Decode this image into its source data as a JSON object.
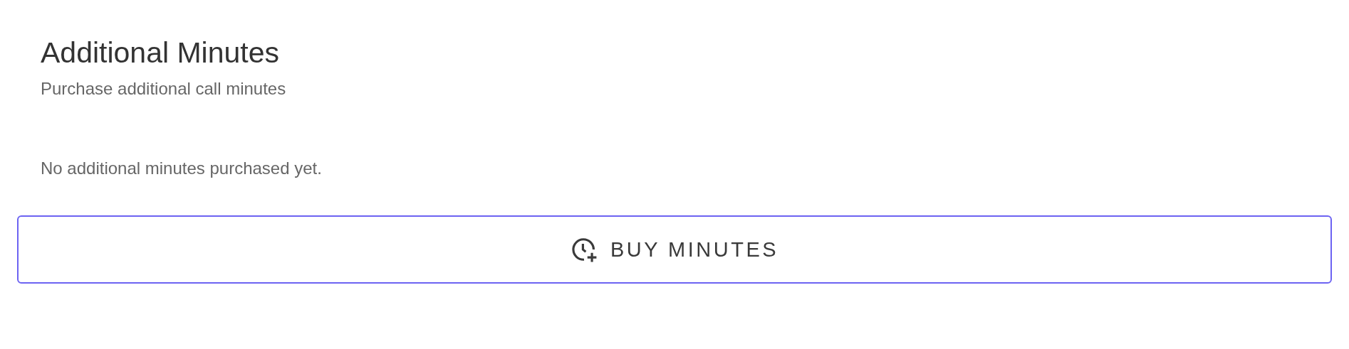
{
  "title": "Additional Minutes",
  "subtitle": "Purchase additional call minutes",
  "empty_message": "No additional minutes purchased yet.",
  "button": {
    "label": "BUY MINUTES"
  }
}
